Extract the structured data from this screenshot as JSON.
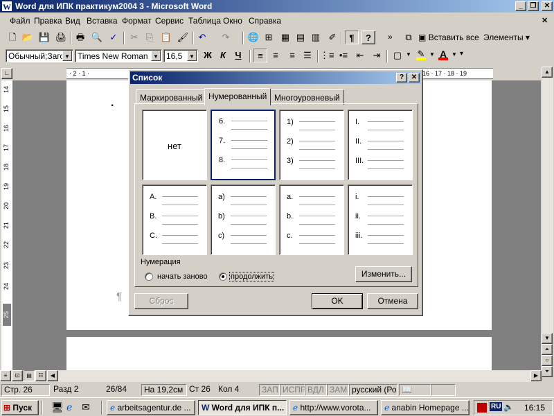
{
  "window": {
    "title": "Word для ИПК практикум2004 3 - Microsoft Word",
    "app_icon": "W",
    "min": "_",
    "max": "❐",
    "close": "✕"
  },
  "menu": {
    "items": [
      "Файл",
      "Правка",
      "Вид",
      "Вставка",
      "Формат",
      "Сервис",
      "Таблица",
      "Окно",
      "Справка"
    ],
    "close": "✕"
  },
  "toolbar_standard": {
    "insert_all": "Вставить все",
    "elements": "Элементы ▾",
    "more": "»",
    "help": "?",
    "pilcrow": "¶"
  },
  "toolbar_format": {
    "style": "Обычный;Загол",
    "font": "Times New Roman",
    "size": "16,5",
    "bold": "Ж",
    "italic": "К",
    "underline": "Ч",
    "highlight": "✎",
    "font_color": "A"
  },
  "ruler": {
    "h_left": "· 2 · 1 ·",
    "h_right": "16 · 17 · 18 · 19",
    "v_numbers": [
      "14",
      "15",
      "16",
      "17",
      "18",
      "19",
      "20",
      "21",
      "22",
      "23",
      "24",
      "25"
    ]
  },
  "document": {
    "bullet": "·",
    "pilcrow": "¶"
  },
  "dialog": {
    "title": "Список",
    "help": "?",
    "close": "✕",
    "tabs": [
      "Маркированный",
      "Нумерованный",
      "Многоуровневый"
    ],
    "active_tab": "Нумерованный",
    "none_label": "нет",
    "cells": [
      [
        "6.",
        "7.",
        "8."
      ],
      [
        "1)",
        "2)",
        "3)"
      ],
      [
        "I.",
        "II.",
        "III."
      ],
      [
        "A.",
        "B.",
        "C."
      ],
      [
        "a)",
        "b)",
        "c)"
      ],
      [
        "a.",
        "b.",
        "c."
      ],
      [
        "i.",
        "ii.",
        "iii."
      ]
    ],
    "numbering_label": "Нумерация",
    "restart_label": "начать заново",
    "continue_label": "продолжить",
    "selected_option": "продолжить",
    "change_button": "Изменить...",
    "reset_button": "Сброс",
    "ok_button": "OK",
    "cancel_button": "Отмена"
  },
  "statusbar": {
    "page": "Стр. 26",
    "section": "Разд 2",
    "pages": "26/84",
    "at": "На 19,2см",
    "line": "Ст 26",
    "col": "Кол 4",
    "rec": "ЗАП",
    "trk": "ИСПР",
    "ext": "ВДЛ",
    "ovr": "ЗАМ",
    "language": "русский (Ро"
  },
  "taskbar": {
    "start": "Пуск",
    "tasks": [
      {
        "label": "arbeitsagentur.de ...",
        "icon": "ie-icon"
      },
      {
        "label": "Word для ИПК п...",
        "icon": "word-icon",
        "active": true
      },
      {
        "label": "http://www.vorota...",
        "icon": "ie-icon"
      },
      {
        "label": "anabin Homepage ...",
        "icon": "ie-icon"
      }
    ],
    "language": "RU",
    "time": "16:15"
  },
  "colors": {
    "titlebar_start": "#0a246a",
    "titlebar_end": "#a6caf0",
    "face": "#d4d0c8"
  }
}
